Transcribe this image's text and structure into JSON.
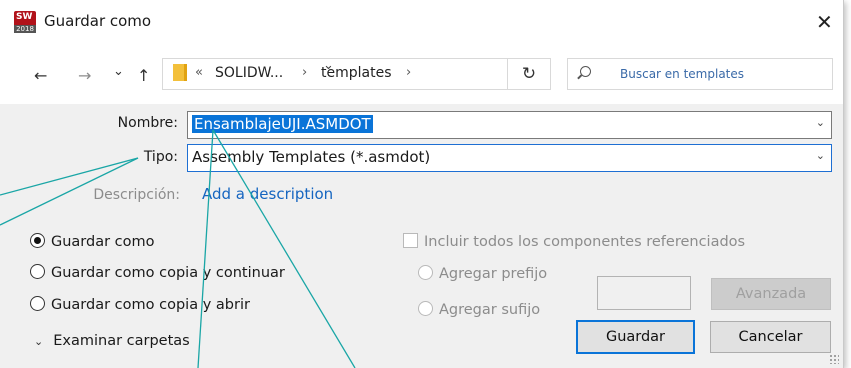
{
  "window": {
    "title": "Guardar como",
    "app_icon_text": "SW",
    "app_icon_year": "2018",
    "close_glyph": "✕"
  },
  "nav": {
    "back_glyph": "←",
    "forward_glyph": "→",
    "recent_glyph": "⌄",
    "up_glyph": "↑",
    "overflow_glyph": "«",
    "crumbs": [
      "SOLIDW...",
      "templates"
    ],
    "crumb_separator": "›",
    "dropdown_glyph": "⌄",
    "refresh_glyph": "↻",
    "search_placeholder": "Buscar en templates"
  },
  "form": {
    "name_label": "Nombre:",
    "name_value": "EnsamblajeUJI.ASMDOT",
    "type_label": "Tipo:",
    "type_value": "Assembly Templates (*.asmdot)",
    "description_label": "Descripción:",
    "description_link": "Add a description",
    "caret_glyph": "⌄"
  },
  "options": {
    "save_as": "Guardar como",
    "save_as_copy_continue": "Guardar como copia y continuar",
    "save_as_copy_open": "Guardar como copia y abrir",
    "include_refs": "Incluir todos los componentes referenciados",
    "add_prefix": "Agregar prefijo",
    "add_suffix": "Agregar sufijo"
  },
  "buttons": {
    "advanced": "Avanzada",
    "save": "Guardar",
    "cancel": "Cancelar"
  },
  "footer": {
    "browse_folders": "Examinar carpetas",
    "browse_glyph": "⌄"
  },
  "colors": {
    "accent": "#0a74d8",
    "annotation_lines": "#1aa6a6"
  }
}
